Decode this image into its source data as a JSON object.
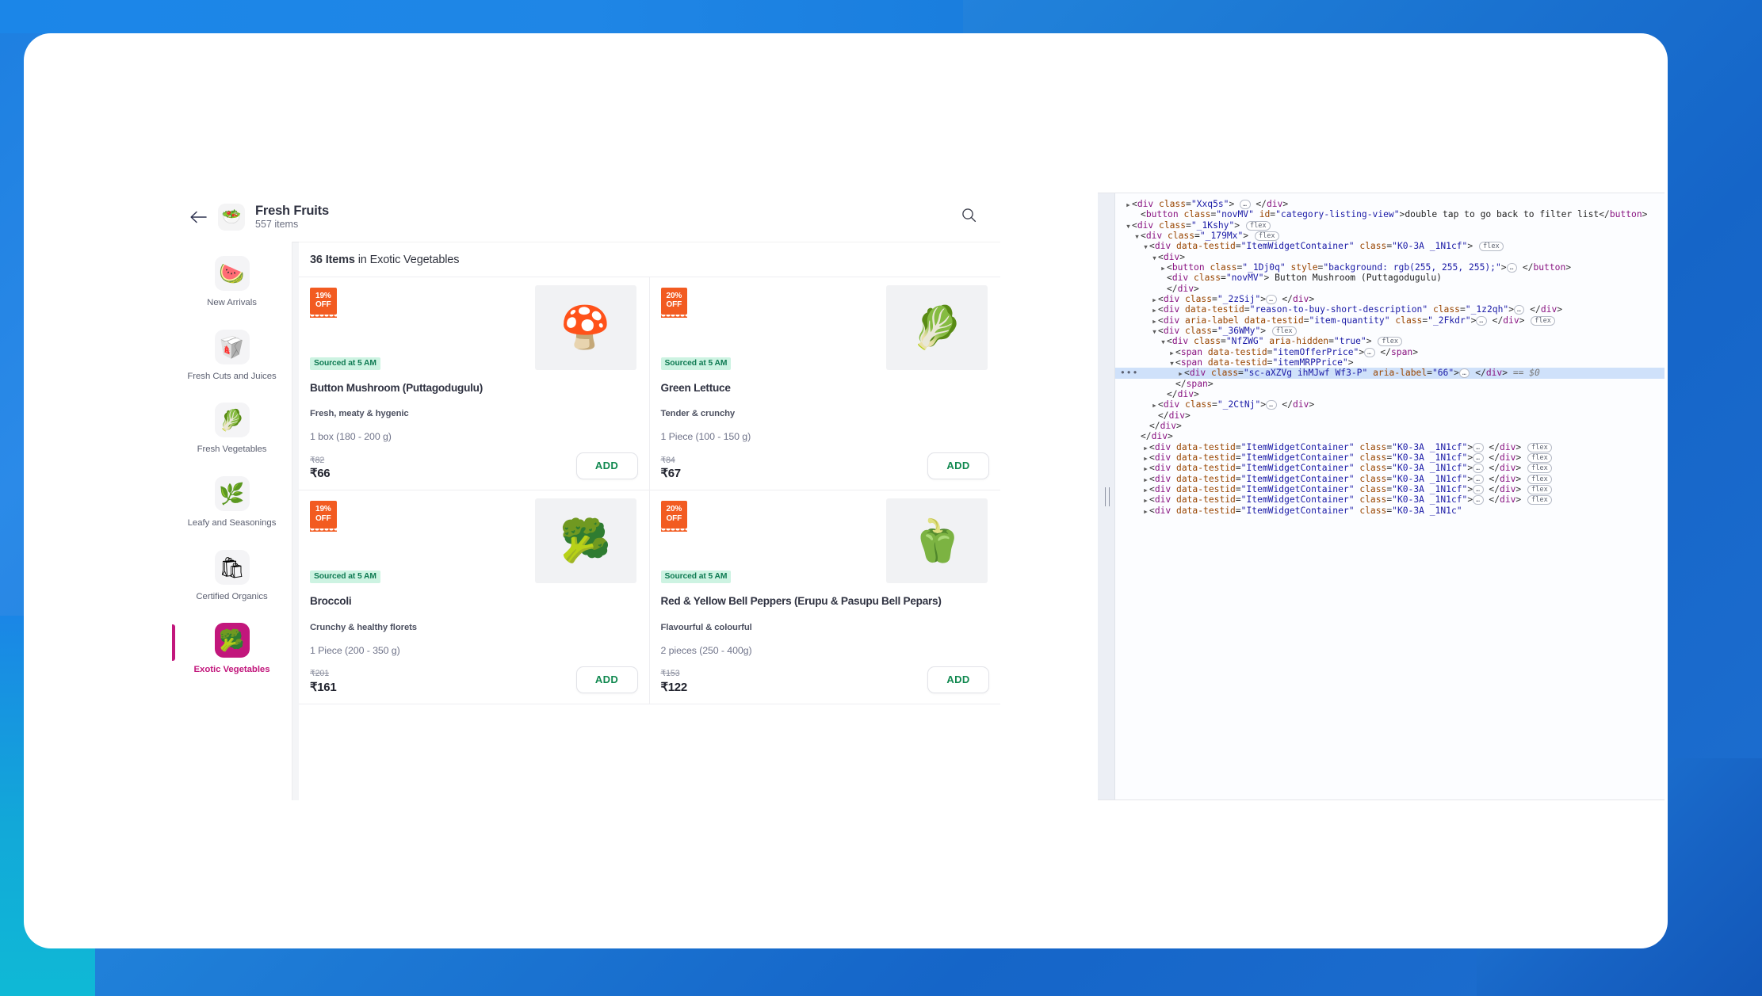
{
  "app": {
    "header": {
      "back_icon": "arrow-left-icon",
      "thumb_icon": "fresh-fruits-basket-icon",
      "thumb_glyph": "🥗",
      "title": "Fresh Fruits",
      "subtitle": "557 items",
      "search_icon": "search-icon"
    },
    "sidebar": {
      "items": [
        {
          "label": "New Arrivals",
          "glyph": "🍉",
          "active": false
        },
        {
          "label": "Fresh Cuts and Juices",
          "glyph": "🥡",
          "active": false
        },
        {
          "label": "Fresh Vegetables",
          "glyph": "🥬",
          "active": false
        },
        {
          "label": "Leafy and Seasonings",
          "glyph": "🌿",
          "active": false
        },
        {
          "label": "Certified Organics",
          "glyph": "🛍",
          "active": false
        },
        {
          "label": "Exotic Vegetables",
          "glyph": "🥦",
          "active": true
        }
      ]
    },
    "results": {
      "count_label": "36 Items",
      "in_label": " in ",
      "category": "Exotic Vegetables"
    },
    "products": [
      {
        "discount": "19%\nOFF",
        "sourced": "Sourced at 5 AM",
        "glyph": "🍄",
        "name": "Button Mushroom (Puttagodugulu)",
        "reason": "Fresh, meaty & hygenic",
        "quantity": "1 box (180 - 200 g)",
        "mrp": "₹82",
        "offer": "₹66",
        "add_label": "ADD"
      },
      {
        "discount": "20%\nOFF",
        "sourced": "Sourced at 5 AM",
        "glyph": "🥬",
        "name": "Green Lettuce",
        "reason": "Tender & crunchy",
        "quantity": "1 Piece (100 - 150 g)",
        "mrp": "₹84",
        "offer": "₹67",
        "add_label": "ADD"
      },
      {
        "discount": "19%\nOFF",
        "sourced": "Sourced at 5 AM",
        "glyph": "🥦",
        "name": "Broccoli",
        "reason": "Crunchy & healthy florets",
        "quantity": "1 Piece (200 - 350 g)",
        "mrp": "₹201",
        "offer": "₹161",
        "add_label": "ADD"
      },
      {
        "discount": "20%\nOFF",
        "sourced": "Sourced at 5 AM",
        "glyph": "🫑",
        "name": "Red & Yellow Bell Peppers (Erupu & Pasupu Bell Pepars)",
        "reason": "Flavourful & colourful",
        "quantity": "2 pieces (250 - 400g)",
        "mrp": "₹153",
        "offer": "₹122",
        "add_label": "ADD"
      }
    ]
  },
  "devtools": {
    "selected_marker": "•••",
    "lines": [
      {
        "id": "l1",
        "indent": 0,
        "arrow": "collapsed",
        "html": "<span class=\"tk-punc\">&lt;</span><span class=\"tk-tag\">div</span> <span class=\"tk-attr\">class</span><span class=\"tk-punc\">=</span><span class=\"tk-val\">\"Xxq5s\"</span><span class=\"tk-punc\">&gt;</span> <span class=\"ell\">…</span> <span class=\"tk-punc\">&lt;/</span><span class=\"tk-tag\">div</span><span class=\"tk-punc\">&gt;</span>"
      },
      {
        "id": "l2",
        "indent": 1,
        "arrow": "none",
        "html": "<span class=\"tk-punc\">&lt;</span><span class=\"tk-tag\">button</span> <span class=\"tk-attr\">class</span><span class=\"tk-punc\">=</span><span class=\"tk-val\">\"novMV\"</span> <span class=\"tk-attr\">id</span><span class=\"tk-punc\">=</span><span class=\"tk-val\">\"category-listing-view\"</span><span class=\"tk-punc\">&gt;</span><span class=\"tk-txt\">double tap to go back to filter list</span><span class=\"tk-punc\">&lt;/</span><span class=\"tk-tag\">button</span><span class=\"tk-punc\">&gt;</span>"
      },
      {
        "id": "l3",
        "indent": 0,
        "arrow": "expanded",
        "html": "<span class=\"tk-punc\">&lt;</span><span class=\"tk-tag\">div</span> <span class=\"tk-attr\">class</span><span class=\"tk-punc\">=</span><span class=\"tk-val\">\"_1Kshy\"</span><span class=\"tk-punc\">&gt;</span> <span class=\"tw\">flex</span>"
      },
      {
        "id": "l4",
        "indent": 1,
        "arrow": "expanded",
        "html": "<span class=\"tk-punc\">&lt;</span><span class=\"tk-tag\">div</span> <span class=\"tk-attr\">class</span><span class=\"tk-punc\">=</span><span class=\"tk-val\">\"_179Mx\"</span><span class=\"tk-punc\">&gt;</span> <span class=\"tw\">flex</span>"
      },
      {
        "id": "l5",
        "indent": 2,
        "arrow": "expanded",
        "html": "<span class=\"tk-punc\">&lt;</span><span class=\"tk-tag\">div</span> <span class=\"tk-attr\">data-testid</span><span class=\"tk-punc\">=</span><span class=\"tk-val\">\"ItemWidgetContainer\"</span> <span class=\"tk-attr\">class</span><span class=\"tk-punc\">=</span><span class=\"tk-val\">\"K0-3A _1N1cf\"</span><span class=\"tk-punc\">&gt;</span> <span class=\"tw\">flex</span>"
      },
      {
        "id": "l6",
        "indent": 3,
        "arrow": "expanded",
        "html": "<span class=\"tk-punc\">&lt;</span><span class=\"tk-tag\">div</span><span class=\"tk-punc\">&gt;</span>"
      },
      {
        "id": "l7",
        "indent": 4,
        "arrow": "collapsed",
        "html": "<span class=\"tk-punc\">&lt;</span><span class=\"tk-tag\">button</span> <span class=\"tk-attr\">class</span><span class=\"tk-punc\">=</span><span class=\"tk-val\">\"_1Dj0q\"</span> <span class=\"tk-attr\">style</span><span class=\"tk-punc\">=</span><span class=\"tk-val\">\"background: rgb(255, 255, 255);\"</span><span class=\"tk-punc\">&gt;</span><span class=\"ell\">…</span> <span class=\"tk-punc\">&lt;/</span><span class=\"tk-tag\">button</span><span class=\"tk-punc\">&gt;</span>"
      },
      {
        "id": "l8",
        "indent": 4,
        "arrow": "none",
        "html": "<span class=\"tk-punc\">&lt;</span><span class=\"tk-tag\">div</span> <span class=\"tk-attr\">class</span><span class=\"tk-punc\">=</span><span class=\"tk-val\">\"novMV\"</span><span class=\"tk-punc\">&gt;</span> <span class=\"tk-txt\">Button Mushroom (Puttagodugulu)</span>"
      },
      {
        "id": "l9",
        "indent": 4,
        "arrow": "none",
        "html": "<span class=\"tk-punc\">&lt;/</span><span class=\"tk-tag\">div</span><span class=\"tk-punc\">&gt;</span>"
      },
      {
        "id": "l10",
        "indent": 3,
        "arrow": "collapsed",
        "html": "<span class=\"tk-punc\">&lt;</span><span class=\"tk-tag\">div</span> <span class=\"tk-attr\">class</span><span class=\"tk-punc\">=</span><span class=\"tk-val\">\"_2zSij\"</span><span class=\"tk-punc\">&gt;</span><span class=\"ell\">…</span> <span class=\"tk-punc\">&lt;/</span><span class=\"tk-tag\">div</span><span class=\"tk-punc\">&gt;</span>"
      },
      {
        "id": "l11",
        "indent": 3,
        "arrow": "collapsed",
        "html": "<span class=\"tk-punc\">&lt;</span><span class=\"tk-tag\">div</span> <span class=\"tk-attr\">data-testid</span><span class=\"tk-punc\">=</span><span class=\"tk-val\">\"reason-to-buy-short-description\"</span> <span class=\"tk-attr\">class</span><span class=\"tk-punc\">=</span><span class=\"tk-val\">\"_1z2qh\"</span><span class=\"tk-punc\">&gt;</span><span class=\"ell\">…</span> <span class=\"tk-punc\">&lt;/</span><span class=\"tk-tag\">div</span><span class=\"tk-punc\">&gt;</span>"
      },
      {
        "id": "l12",
        "indent": 3,
        "arrow": "collapsed",
        "html": "<span class=\"tk-punc\">&lt;</span><span class=\"tk-tag\">div</span> <span class=\"tk-attr\">aria-label</span> <span class=\"tk-attr\">data-testid</span><span class=\"tk-punc\">=</span><span class=\"tk-val\">\"item-quantity\"</span> <span class=\"tk-attr\">class</span><span class=\"tk-punc\">=</span><span class=\"tk-val\">\"_2Fkdr\"</span><span class=\"tk-punc\">&gt;</span><span class=\"ell\">…</span> <span class=\"tk-punc\">&lt;/</span><span class=\"tk-tag\">div</span><span class=\"tk-punc\">&gt;</span> <span class=\"tw\">flex</span>"
      },
      {
        "id": "l13",
        "indent": 3,
        "arrow": "expanded",
        "html": "<span class=\"tk-punc\">&lt;</span><span class=\"tk-tag\">div</span> <span class=\"tk-attr\">class</span><span class=\"tk-punc\">=</span><span class=\"tk-val\">\"_36WMy\"</span><span class=\"tk-punc\">&gt;</span> <span class=\"tw\">flex</span>"
      },
      {
        "id": "l14",
        "indent": 4,
        "arrow": "expanded",
        "html": "<span class=\"tk-punc\">&lt;</span><span class=\"tk-tag\">div</span> <span class=\"tk-attr\">class</span><span class=\"tk-punc\">=</span><span class=\"tk-val\">\"NfZWG\"</span> <span class=\"tk-attr\">aria-hidden</span><span class=\"tk-punc\">=</span><span class=\"tk-val\">\"true\"</span><span class=\"tk-punc\">&gt;</span> <span class=\"tw\">flex</span>"
      },
      {
        "id": "l15",
        "indent": 5,
        "arrow": "collapsed",
        "html": "<span class=\"tk-punc\">&lt;</span><span class=\"tk-tag\">span</span> <span class=\"tk-attr\">data-testid</span><span class=\"tk-punc\">=</span><span class=\"tk-val\">\"itemOfferPrice\"</span><span class=\"tk-punc\">&gt;</span><span class=\"ell\">…</span> <span class=\"tk-punc\">&lt;/</span><span class=\"tk-tag\">span</span><span class=\"tk-punc\">&gt;</span>"
      },
      {
        "id": "l16",
        "indent": 5,
        "arrow": "expanded",
        "html": "<span class=\"tk-punc\">&lt;</span><span class=\"tk-tag\">span</span> <span class=\"tk-attr\">data-testid</span><span class=\"tk-punc\">=</span><span class=\"tk-val\">\"itemMRPPrice\"</span><span class=\"tk-punc\">&gt;</span>"
      },
      {
        "id": "l17",
        "indent": 6,
        "arrow": "collapsed",
        "selected": true,
        "html": "<span class=\"tk-punc\">&lt;</span><span class=\"tk-tag\">div</span> <span class=\"tk-attr\">class</span><span class=\"tk-punc\">=</span><span class=\"tk-val\">\"sc-aXZVg ihMJwf Wf3-P\"</span> <span class=\"tk-attr\">aria-label</span><span class=\"tk-punc\">=</span><span class=\"tk-val\">\"66\"</span><span class=\"tk-punc\">&gt;</span><span class=\"ell\">…</span> <span class=\"tk-punc\">&lt;/</span><span class=\"tk-tag\">div</span><span class=\"tk-punc\">&gt;</span> <span class=\"tk-dim\">== $0</span>"
      },
      {
        "id": "l18",
        "indent": 5,
        "arrow": "none",
        "html": "<span class=\"tk-punc\">&lt;/</span><span class=\"tk-tag\">span</span><span class=\"tk-punc\">&gt;</span>"
      },
      {
        "id": "l19",
        "indent": 4,
        "arrow": "none",
        "html": "<span class=\"tk-punc\">&lt;/</span><span class=\"tk-tag\">div</span><span class=\"tk-punc\">&gt;</span>"
      },
      {
        "id": "l20",
        "indent": 3,
        "arrow": "collapsed",
        "html": "<span class=\"tk-punc\">&lt;</span><span class=\"tk-tag\">div</span> <span class=\"tk-attr\">class</span><span class=\"tk-punc\">=</span><span class=\"tk-val\">\"_2CtNj\"</span><span class=\"tk-punc\">&gt;</span><span class=\"ell\">…</span> <span class=\"tk-punc\">&lt;/</span><span class=\"tk-tag\">div</span><span class=\"tk-punc\">&gt;</span>"
      },
      {
        "id": "l21",
        "indent": 3,
        "arrow": "none",
        "html": "<span class=\"tk-punc\">&lt;/</span><span class=\"tk-tag\">div</span><span class=\"tk-punc\">&gt;</span>"
      },
      {
        "id": "l22",
        "indent": 2,
        "arrow": "none",
        "html": "<span class=\"tk-punc\">&lt;/</span><span class=\"tk-tag\">div</span><span class=\"tk-punc\">&gt;</span>"
      },
      {
        "id": "l23",
        "indent": 1,
        "arrow": "none",
        "html": "<span class=\"tk-punc\">&lt;/</span><span class=\"tk-tag\">div</span><span class=\"tk-punc\">&gt;</span>"
      },
      {
        "id": "l24",
        "indent": 2,
        "arrow": "collapsed",
        "html": "<span class=\"tk-punc\">&lt;</span><span class=\"tk-tag\">div</span> <span class=\"tk-attr\">data-testid</span><span class=\"tk-punc\">=</span><span class=\"tk-val\">\"ItemWidgetContainer\"</span> <span class=\"tk-attr\">class</span><span class=\"tk-punc\">=</span><span class=\"tk-val\">\"K0-3A _1N1cf\"</span><span class=\"tk-punc\">&gt;</span><span class=\"ell\">…</span> <span class=\"tk-punc\">&lt;/</span><span class=\"tk-tag\">div</span><span class=\"tk-punc\">&gt;</span> <span class=\"tw\">flex</span>"
      },
      {
        "id": "l25",
        "indent": 2,
        "arrow": "collapsed",
        "html": "<span class=\"tk-punc\">&lt;</span><span class=\"tk-tag\">div</span> <span class=\"tk-attr\">data-testid</span><span class=\"tk-punc\">=</span><span class=\"tk-val\">\"ItemWidgetContainer\"</span> <span class=\"tk-attr\">class</span><span class=\"tk-punc\">=</span><span class=\"tk-val\">\"K0-3A _1N1cf\"</span><span class=\"tk-punc\">&gt;</span><span class=\"ell\">…</span> <span class=\"tk-punc\">&lt;/</span><span class=\"tk-tag\">div</span><span class=\"tk-punc\">&gt;</span> <span class=\"tw\">flex</span>"
      },
      {
        "id": "l26",
        "indent": 2,
        "arrow": "collapsed",
        "html": "<span class=\"tk-punc\">&lt;</span><span class=\"tk-tag\">div</span> <span class=\"tk-attr\">data-testid</span><span class=\"tk-punc\">=</span><span class=\"tk-val\">\"ItemWidgetContainer\"</span> <span class=\"tk-attr\">class</span><span class=\"tk-punc\">=</span><span class=\"tk-val\">\"K0-3A _1N1cf\"</span><span class=\"tk-punc\">&gt;</span><span class=\"ell\">…</span> <span class=\"tk-punc\">&lt;/</span><span class=\"tk-tag\">div</span><span class=\"tk-punc\">&gt;</span> <span class=\"tw\">flex</span>"
      },
      {
        "id": "l27",
        "indent": 2,
        "arrow": "collapsed",
        "html": "<span class=\"tk-punc\">&lt;</span><span class=\"tk-tag\">div</span> <span class=\"tk-attr\">data-testid</span><span class=\"tk-punc\">=</span><span class=\"tk-val\">\"ItemWidgetContainer\"</span> <span class=\"tk-attr\">class</span><span class=\"tk-punc\">=</span><span class=\"tk-val\">\"K0-3A _1N1cf\"</span><span class=\"tk-punc\">&gt;</span><span class=\"ell\">…</span> <span class=\"tk-punc\">&lt;/</span><span class=\"tk-tag\">div</span><span class=\"tk-punc\">&gt;</span> <span class=\"tw\">flex</span>"
      },
      {
        "id": "l28",
        "indent": 2,
        "arrow": "collapsed",
        "html": "<span class=\"tk-punc\">&lt;</span><span class=\"tk-tag\">div</span> <span class=\"tk-attr\">data-testid</span><span class=\"tk-punc\">=</span><span class=\"tk-val\">\"ItemWidgetContainer\"</span> <span class=\"tk-attr\">class</span><span class=\"tk-punc\">=</span><span class=\"tk-val\">\"K0-3A _1N1cf\"</span><span class=\"tk-punc\">&gt;</span><span class=\"ell\">…</span> <span class=\"tk-punc\">&lt;/</span><span class=\"tk-tag\">div</span><span class=\"tk-punc\">&gt;</span> <span class=\"tw\">flex</span>"
      },
      {
        "id": "l29",
        "indent": 2,
        "arrow": "collapsed",
        "html": "<span class=\"tk-punc\">&lt;</span><span class=\"tk-tag\">div</span> <span class=\"tk-attr\">data-testid</span><span class=\"tk-punc\">=</span><span class=\"tk-val\">\"ItemWidgetContainer\"</span> <span class=\"tk-attr\">class</span><span class=\"tk-punc\">=</span><span class=\"tk-val\">\"K0-3A _1N1cf\"</span><span class=\"tk-punc\">&gt;</span><span class=\"ell\">…</span> <span class=\"tk-punc\">&lt;/</span><span class=\"tk-tag\">div</span><span class=\"tk-punc\">&gt;</span> <span class=\"tw\">flex</span>"
      },
      {
        "id": "l30",
        "indent": 2,
        "arrow": "collapsed",
        "html": "<span class=\"tk-punc\">&lt;</span><span class=\"tk-tag\">div</span> <span class=\"tk-attr\">data-testid</span><span class=\"tk-punc\">=</span><span class=\"tk-val\">\"ItemWidgetContainer\"</span> <span class=\"tk-attr\">class</span><span class=\"tk-punc\">=</span><span class=\"tk-val\">\"K0-3A _1N1c\"</span>"
      }
    ]
  }
}
